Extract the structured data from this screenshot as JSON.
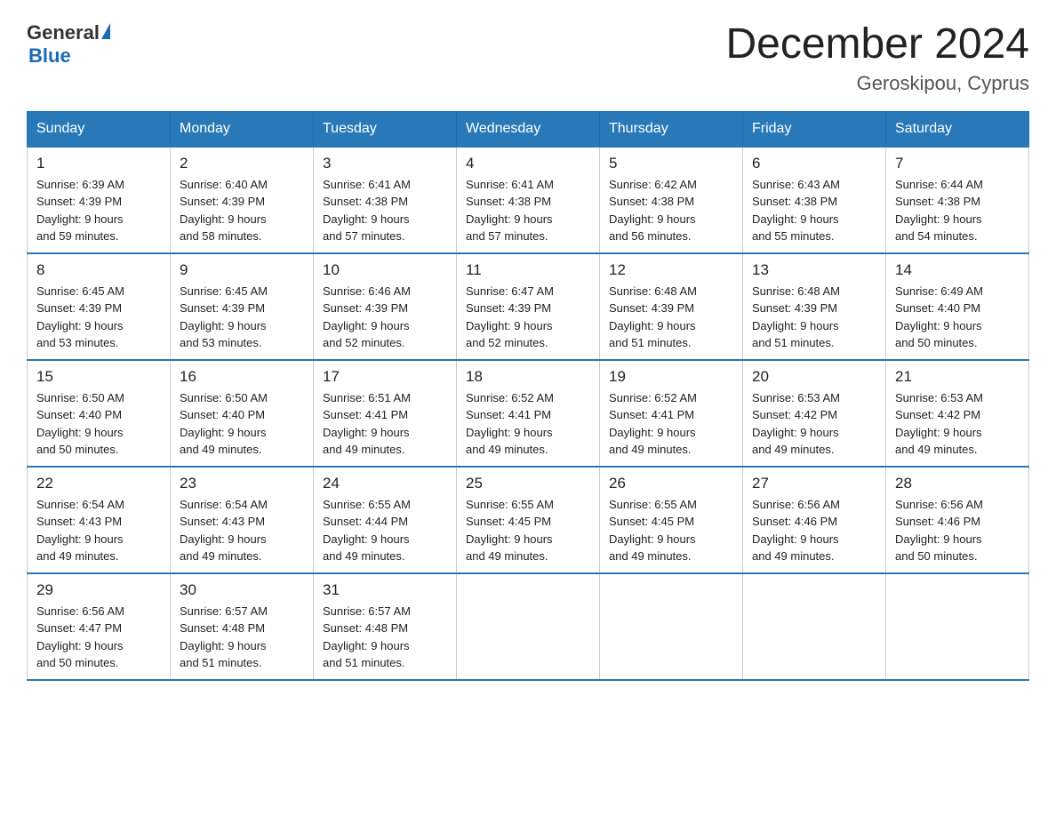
{
  "header": {
    "logo_general": "General",
    "logo_triangle": "",
    "logo_blue": "Blue",
    "month_title": "December 2024",
    "location": "Geroskipou, Cyprus"
  },
  "columns": [
    "Sunday",
    "Monday",
    "Tuesday",
    "Wednesday",
    "Thursday",
    "Friday",
    "Saturday"
  ],
  "weeks": [
    [
      {
        "day": "1",
        "sunrise": "6:39 AM",
        "sunset": "4:39 PM",
        "daylight": "9 hours and 59 minutes."
      },
      {
        "day": "2",
        "sunrise": "6:40 AM",
        "sunset": "4:39 PM",
        "daylight": "9 hours and 58 minutes."
      },
      {
        "day": "3",
        "sunrise": "6:41 AM",
        "sunset": "4:38 PM",
        "daylight": "9 hours and 57 minutes."
      },
      {
        "day": "4",
        "sunrise": "6:41 AM",
        "sunset": "4:38 PM",
        "daylight": "9 hours and 57 minutes."
      },
      {
        "day": "5",
        "sunrise": "6:42 AM",
        "sunset": "4:38 PM",
        "daylight": "9 hours and 56 minutes."
      },
      {
        "day": "6",
        "sunrise": "6:43 AM",
        "sunset": "4:38 PM",
        "daylight": "9 hours and 55 minutes."
      },
      {
        "day": "7",
        "sunrise": "6:44 AM",
        "sunset": "4:38 PM",
        "daylight": "9 hours and 54 minutes."
      }
    ],
    [
      {
        "day": "8",
        "sunrise": "6:45 AM",
        "sunset": "4:39 PM",
        "daylight": "9 hours and 53 minutes."
      },
      {
        "day": "9",
        "sunrise": "6:45 AM",
        "sunset": "4:39 PM",
        "daylight": "9 hours and 53 minutes."
      },
      {
        "day": "10",
        "sunrise": "6:46 AM",
        "sunset": "4:39 PM",
        "daylight": "9 hours and 52 minutes."
      },
      {
        "day": "11",
        "sunrise": "6:47 AM",
        "sunset": "4:39 PM",
        "daylight": "9 hours and 52 minutes."
      },
      {
        "day": "12",
        "sunrise": "6:48 AM",
        "sunset": "4:39 PM",
        "daylight": "9 hours and 51 minutes."
      },
      {
        "day": "13",
        "sunrise": "6:48 AM",
        "sunset": "4:39 PM",
        "daylight": "9 hours and 51 minutes."
      },
      {
        "day": "14",
        "sunrise": "6:49 AM",
        "sunset": "4:40 PM",
        "daylight": "9 hours and 50 minutes."
      }
    ],
    [
      {
        "day": "15",
        "sunrise": "6:50 AM",
        "sunset": "4:40 PM",
        "daylight": "9 hours and 50 minutes."
      },
      {
        "day": "16",
        "sunrise": "6:50 AM",
        "sunset": "4:40 PM",
        "daylight": "9 hours and 49 minutes."
      },
      {
        "day": "17",
        "sunrise": "6:51 AM",
        "sunset": "4:41 PM",
        "daylight": "9 hours and 49 minutes."
      },
      {
        "day": "18",
        "sunrise": "6:52 AM",
        "sunset": "4:41 PM",
        "daylight": "9 hours and 49 minutes."
      },
      {
        "day": "19",
        "sunrise": "6:52 AM",
        "sunset": "4:41 PM",
        "daylight": "9 hours and 49 minutes."
      },
      {
        "day": "20",
        "sunrise": "6:53 AM",
        "sunset": "4:42 PM",
        "daylight": "9 hours and 49 minutes."
      },
      {
        "day": "21",
        "sunrise": "6:53 AM",
        "sunset": "4:42 PM",
        "daylight": "9 hours and 49 minutes."
      }
    ],
    [
      {
        "day": "22",
        "sunrise": "6:54 AM",
        "sunset": "4:43 PM",
        "daylight": "9 hours and 49 minutes."
      },
      {
        "day": "23",
        "sunrise": "6:54 AM",
        "sunset": "4:43 PM",
        "daylight": "9 hours and 49 minutes."
      },
      {
        "day": "24",
        "sunrise": "6:55 AM",
        "sunset": "4:44 PM",
        "daylight": "9 hours and 49 minutes."
      },
      {
        "day": "25",
        "sunrise": "6:55 AM",
        "sunset": "4:45 PM",
        "daylight": "9 hours and 49 minutes."
      },
      {
        "day": "26",
        "sunrise": "6:55 AM",
        "sunset": "4:45 PM",
        "daylight": "9 hours and 49 minutes."
      },
      {
        "day": "27",
        "sunrise": "6:56 AM",
        "sunset": "4:46 PM",
        "daylight": "9 hours and 49 minutes."
      },
      {
        "day": "28",
        "sunrise": "6:56 AM",
        "sunset": "4:46 PM",
        "daylight": "9 hours and 50 minutes."
      }
    ],
    [
      {
        "day": "29",
        "sunrise": "6:56 AM",
        "sunset": "4:47 PM",
        "daylight": "9 hours and 50 minutes."
      },
      {
        "day": "30",
        "sunrise": "6:57 AM",
        "sunset": "4:48 PM",
        "daylight": "9 hours and 51 minutes."
      },
      {
        "day": "31",
        "sunrise": "6:57 AM",
        "sunset": "4:48 PM",
        "daylight": "9 hours and 51 minutes."
      },
      null,
      null,
      null,
      null
    ]
  ]
}
